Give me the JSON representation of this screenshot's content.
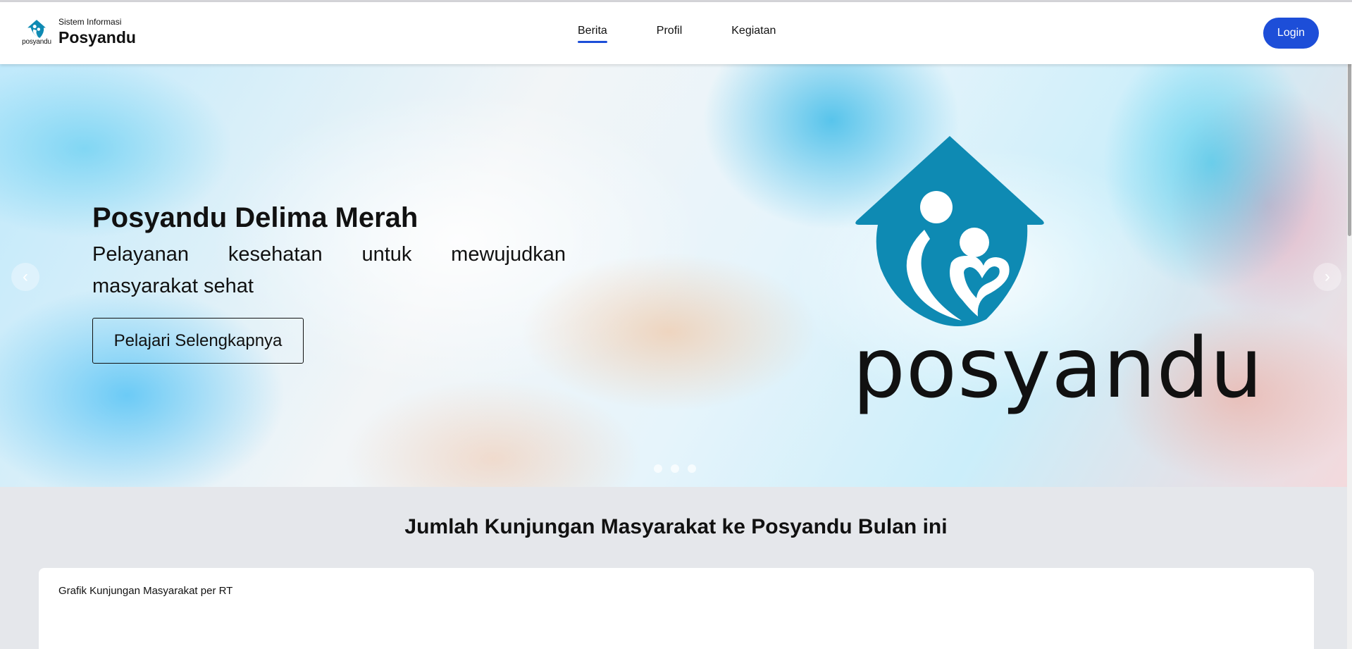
{
  "header": {
    "brand_logo_word": "posyandu",
    "brand_subtitle": "Sistem Informasi",
    "brand_title": "Posyandu",
    "nav": [
      {
        "label": "Berita",
        "active": true
      },
      {
        "label": "Profil",
        "active": false
      },
      {
        "label": "Kegiatan",
        "active": false
      }
    ],
    "login_label": "Login"
  },
  "hero": {
    "title": "Posyandu Delima Merah",
    "description": "Pelayanan kesehatan untuk mewujudkan masyarakat sehat",
    "cta_label": "Pelajari Selengkapnya",
    "logo_word": "posyandu",
    "prev_icon": "chevron-left-icon",
    "next_icon": "chevron-right-icon",
    "slide_count": 3,
    "active_slide": 1
  },
  "section": {
    "title": "Jumlah Kunjungan Masyarakat ke Posyandu Bulan ini"
  },
  "chart_card": {
    "title": "Grafik Kunjungan Masyarakat per RT"
  },
  "colors": {
    "accent": "#1d4ed8",
    "logo_blue": "#0e8ab3",
    "section_bg": "#e5e7eb"
  }
}
